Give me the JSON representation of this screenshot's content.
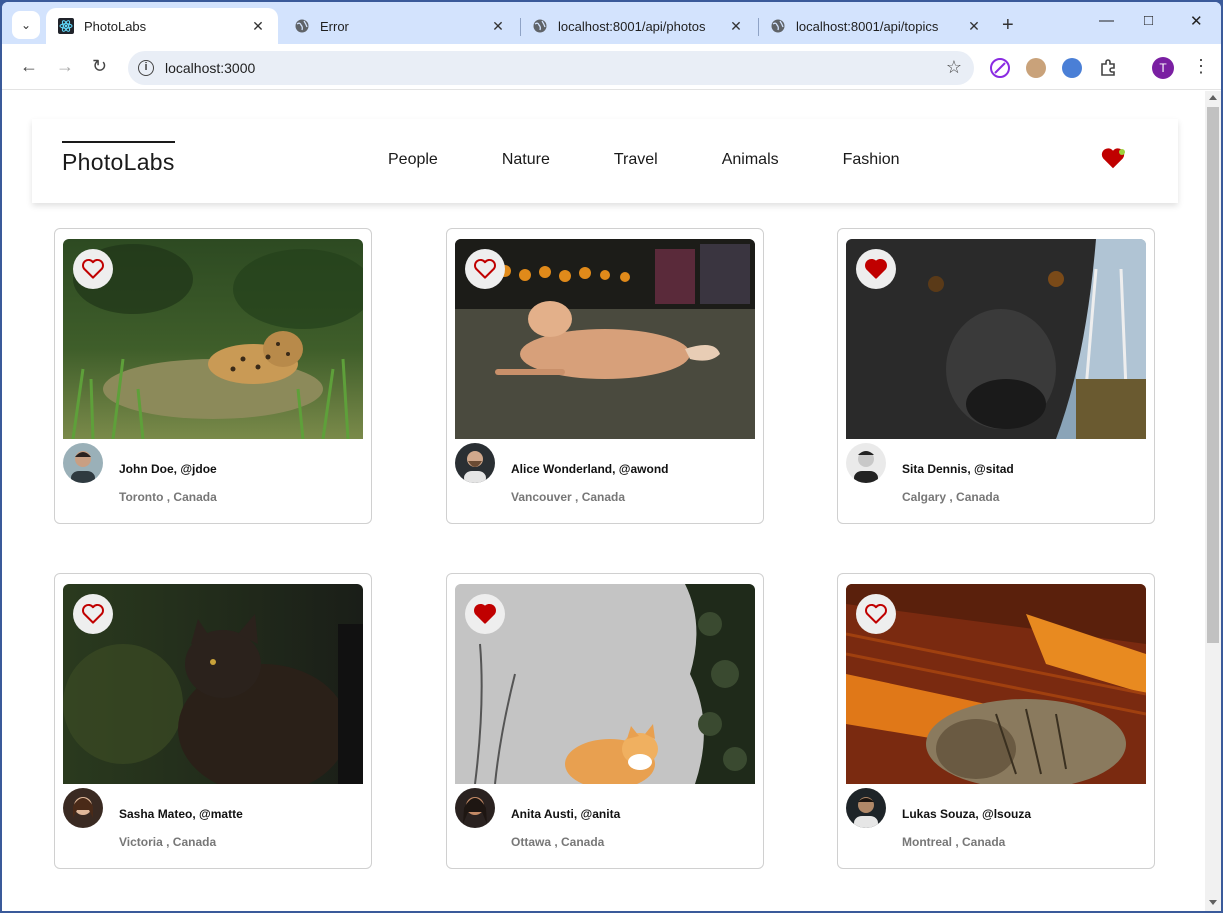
{
  "browser": {
    "tabs": [
      {
        "title": "PhotoLabs",
        "active": true,
        "favicon": "react-icon"
      },
      {
        "title": "Error",
        "active": false,
        "favicon": "globe-icon"
      },
      {
        "title": "localhost:8001/api/photos",
        "active": false,
        "favicon": "globe-icon"
      },
      {
        "title": "localhost:8001/api/topics",
        "active": false,
        "favicon": "globe-icon"
      }
    ],
    "url": "localhost:3000",
    "profile_initial": "T"
  },
  "app": {
    "logo": "PhotoLabs",
    "topics": [
      "People",
      "Nature",
      "Travel",
      "Animals",
      "Fashion"
    ],
    "has_favourites": true,
    "photos": [
      {
        "name": "John Doe, @jdoe",
        "location": "Toronto , Canada",
        "liked": false,
        "subject": "jaguar in grass"
      },
      {
        "name": "Alice Wonderland, @awond",
        "location": "Vancouver , Canada",
        "liked": false,
        "subject": "dog lying on grass"
      },
      {
        "name": "Sita Dennis, @sitad",
        "location": "Calgary , Canada",
        "liked": true,
        "subject": "black dog close-up"
      },
      {
        "name": "Sasha Mateo, @matte",
        "location": "Victoria , Canada",
        "liked": false,
        "subject": "black cat"
      },
      {
        "name": "Anita Austi, @anita",
        "location": "Ottawa , Canada",
        "liked": true,
        "subject": "orange cat by wall"
      },
      {
        "name": "Lukas Souza, @lsouza",
        "location": "Montreal , Canada",
        "liked": false,
        "subject": "cat in sunlight"
      }
    ]
  },
  "colors": {
    "heart_red": "#c00000",
    "tabstrip": "#d3e3fd",
    "fav_dot": "#9cd33c"
  }
}
